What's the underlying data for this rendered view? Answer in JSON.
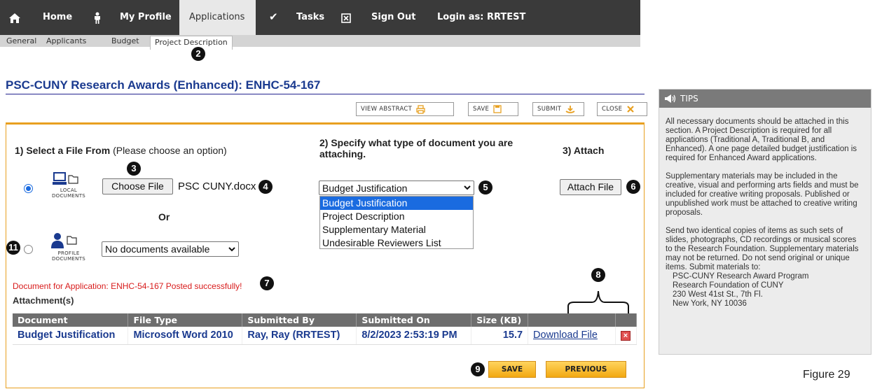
{
  "nav": {
    "home": "Home",
    "profile": "My Profile",
    "applications": "Applications",
    "tasks": "Tasks",
    "signout": "Sign Out",
    "login": "Login as: RRTEST"
  },
  "subtabs": [
    "General",
    "Applicants",
    "Budget",
    "Project Description"
  ],
  "page_title": "PSC-CUNY Research Awards (Enhanced): ENHC-54-167",
  "toolbar": {
    "view_abstract": "VIEW ABSTRACT",
    "save": "SAVE",
    "submit": "SUBMIT",
    "close": "CLOSE"
  },
  "step1": {
    "bold": "1) Select a File From",
    "normal": "(Please choose an option)"
  },
  "step2": {
    "label": "2) Specify what type of document you are attaching."
  },
  "step3": {
    "label": "3) Attach"
  },
  "local": {
    "label_line1": "LOCAL",
    "label_line2": "DOCUMENTS",
    "choose_file": "Choose File",
    "file_name": "PSC CUNY.docx"
  },
  "or_text": "Or",
  "profile_docs": {
    "label_line1": "PROFILE",
    "label_line2": "DOCUMENTS",
    "select_value": "No documents available"
  },
  "doc_type": {
    "selected": "Budget Justification",
    "options": [
      "Budget Justification",
      "Project Description",
      "Supplementary Material",
      "Undesirable Reviewers List"
    ]
  },
  "attach_file": "Attach File",
  "success_msg": "Document for Application: ENHC-54-167 Posted successfully!",
  "attachments_header": "Attachment(s)",
  "table": {
    "headers": [
      "Document",
      "File Type",
      "Submitted By",
      "Submitted On",
      "Size (KB)"
    ],
    "rows": [
      {
        "document": "Budget Justification",
        "file_type": "Microsoft Word 2010",
        "submitted_by": "Ray, Ray (RRTEST)",
        "submitted_on": "8/2/2023 2:53:19 PM",
        "size": "15.7",
        "download": "Download File"
      }
    ]
  },
  "bottom": {
    "save": "SAVE",
    "previous": "PREVIOUS"
  },
  "badges": {
    "b2": "2",
    "b3": "3",
    "b4": "4",
    "b5": "5",
    "b6": "6",
    "b7": "7",
    "b8": "8",
    "b9": "9",
    "b11": "11"
  },
  "tips": {
    "title": "TIPS",
    "p1": "All necessary documents should be attached in this section. A Project Description is required for all applications (Traditional A, Traditional B, and Enhanced). A one page detailed budget justification is required for Enhanced Award applications.",
    "p2": "Supplementary materials may be included in the creative, visual and performing arts fields and must be included for creative writing proposals. Published or unpublished work must be attached to creative writing proposals.",
    "p3": "Send two identical copies of items as such sets of slides, photographs, CD recordings or musical scores to the Research Foundation. Supplementary materials may not be returned. Do not send original or unique items. Submit materials to:",
    "addr1": "PSC-CUNY Research Award Program",
    "addr2": "Research Foundation of CUNY",
    "addr3": "230 West 41st St., 7th Fl.",
    "addr4": "New York, NY 10036"
  },
  "figure_caption": "Figure 29",
  "colors": {
    "nav_bg": "#3a3a3a",
    "accent": "#e8a020",
    "title_blue": "#1a3a8f",
    "error_red": "#d81b1b",
    "select_blue": "#1a6be0"
  }
}
